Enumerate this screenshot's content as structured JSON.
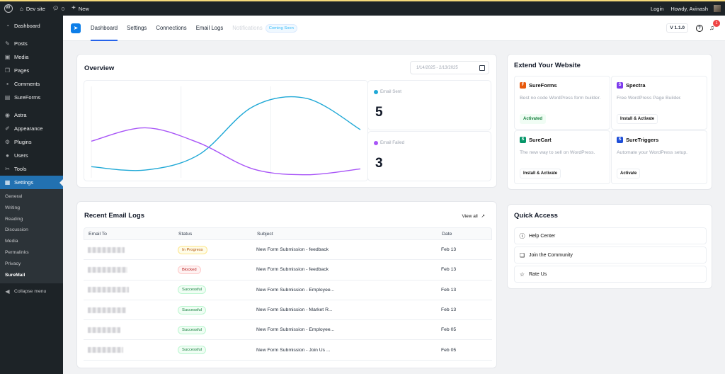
{
  "adminbar": {
    "site_name": "Dev site",
    "comments_count": "0",
    "new_label": "New",
    "login_label": "Login",
    "howdy_label": "Howdy, Avinash"
  },
  "sidebar": {
    "items": [
      {
        "label": "Dashboard",
        "icon": "dashboard-icon"
      },
      {
        "label": "Posts",
        "icon": "pin-icon"
      },
      {
        "label": "Media",
        "icon": "media-icon"
      },
      {
        "label": "Pages",
        "icon": "pages-icon"
      },
      {
        "label": "Comments",
        "icon": "comment-icon"
      },
      {
        "label": "SureForms",
        "icon": "sureforms-icon"
      },
      {
        "label": "Astra",
        "icon": "astra-icon"
      },
      {
        "label": "Appearance",
        "icon": "brush-icon"
      },
      {
        "label": "Plugins",
        "icon": "plugin-icon"
      },
      {
        "label": "Users",
        "icon": "users-icon"
      },
      {
        "label": "Tools",
        "icon": "wrench-icon"
      },
      {
        "label": "Settings",
        "icon": "settings-icon"
      }
    ],
    "submenu": [
      "General",
      "Writing",
      "Reading",
      "Discussion",
      "Media",
      "Permalinks",
      "Privacy",
      "SureMail"
    ],
    "collapse_label": "Collapse menu"
  },
  "plugin_nav": {
    "tabs": [
      "Dashboard",
      "Settings",
      "Connections",
      "Email Logs"
    ],
    "disabled_tab": "Notifications",
    "coming_soon": "Coming Soon",
    "version": "V 1.1.0",
    "notification_count": "1"
  },
  "overview": {
    "title": "Overview",
    "date_range": "1/14/2025 - 2/13/2025",
    "sent_label": "Email Sent",
    "sent_value": "5",
    "failed_label": "Email Failed",
    "failed_value": "3",
    "colors": {
      "sent": "#1fa8d6",
      "failed": "#a855f7"
    }
  },
  "chart_data": {
    "type": "line",
    "series": [
      {
        "name": "Email Sent",
        "values": [
          0.58,
          0.36,
          1.36,
          4.46,
          5.0,
          2.98
        ]
      },
      {
        "name": "Email Failed",
        "values": [
          2.23,
          3.1,
          2.12,
          0.44,
          0.06,
          0.44
        ]
      }
    ],
    "ylim": [
      0,
      5.5
    ],
    "grid": true
  },
  "logs": {
    "title": "Recent Email Logs",
    "view_all": "View all",
    "columns": [
      "Email To",
      "Status",
      "Subject",
      "Date"
    ],
    "rows": [
      {
        "status": "In Progress",
        "kind": "progress",
        "subject": "New Form Submission - feedback",
        "date": "Feb 13"
      },
      {
        "status": "Blocked",
        "kind": "blocked",
        "subject": "New Form Submission - feedback",
        "date": "Feb 13"
      },
      {
        "status": "Successful",
        "kind": "success",
        "subject": "New Form Submission - Employee...",
        "date": "Feb 13"
      },
      {
        "status": "Successful",
        "kind": "success",
        "subject": "New Form Submission - Market R...",
        "date": "Feb 13"
      },
      {
        "status": "Successful",
        "kind": "success",
        "subject": "New Form Submission - Employee...",
        "date": "Feb 05"
      },
      {
        "status": "Successful",
        "kind": "success",
        "subject": "New Form Submission - Join Us ...",
        "date": "Feb 05"
      }
    ]
  },
  "extend": {
    "title": "Extend Your Website",
    "items": [
      {
        "name": "SureForms",
        "desc": "Best no code WordPress form builder.",
        "button": "Activated",
        "icon_color": "#e8590c",
        "icon_char": "F"
      },
      {
        "name": "Spectra",
        "desc": "Free WordPress Page Builder.",
        "button": "Install & Activate",
        "icon_color": "#7c3aed",
        "icon_char": "S"
      },
      {
        "name": "SureCart",
        "desc": "The new way to sell on WordPress.",
        "button": "Install & Activate",
        "icon_color": "#059669",
        "icon_char": "S"
      },
      {
        "name": "SureTriggers",
        "desc": "Automate your WordPress setup.",
        "button": "Activate",
        "icon_color": "#1d4ed8",
        "icon_char": "S"
      }
    ]
  },
  "quick_access": {
    "title": "Quick Access",
    "items": [
      {
        "label": "Help Center",
        "icon": "help-circle-icon"
      },
      {
        "label": "Join the Community",
        "icon": "chat-bubbles-icon"
      },
      {
        "label": "Rate Us",
        "icon": "star-icon"
      }
    ]
  }
}
